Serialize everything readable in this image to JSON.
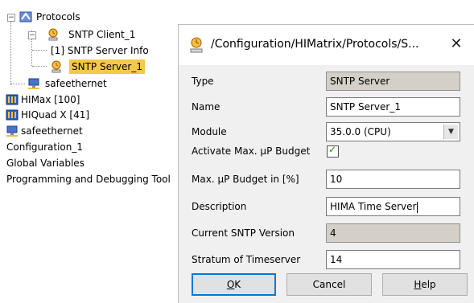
{
  "tree": {
    "protocols": "Protocols",
    "sntp_client": "SNTP Client_1",
    "sntp_server_info": "[1] SNTP Server Info",
    "sntp_server": "SNTP Server_1",
    "safeethernet_1": "safeethernet",
    "himax": "HIMax [100]",
    "hiquad": "HIQuad X [41]",
    "safeethernet_2": "safeethernet",
    "configuration": "Configuration_1",
    "global_variables": "Global Variables",
    "programming_tools": "Programming and Debugging Tool"
  },
  "dialog": {
    "title": "/Configuration/HIMatrix/Protocols/S...",
    "close_glyph": "✕",
    "fields": {
      "type_label": "Type",
      "type_value": "SNTP Server",
      "name_label": "Name",
      "name_value": "SNTP Server_1",
      "module_label": "Module",
      "module_value": "35.0.0 (CPU)",
      "activate_label": "Activate Max. µP Budget",
      "activate_checked": true,
      "budget_label": "Max. µP Budget in [%]",
      "budget_value": "10",
      "description_label": "Description",
      "description_value": "HIMA Time Server",
      "version_label": "Current SNTP Version",
      "version_value": "4",
      "stratum_label": "Stratum of Timeserver",
      "stratum_value": "14"
    },
    "buttons": {
      "ok_mnemonic": "O",
      "ok_rest": "K",
      "cancel": "Cancel",
      "help_mnemonic": "H",
      "help_rest": "elp"
    }
  },
  "colors": {
    "selection": "#f5c84a",
    "dialog_bg": "#f0f0f0",
    "readonly_bg": "#d4d0c8",
    "default_button_border": "#0078d7",
    "checkmark": "#1a8a1a"
  }
}
